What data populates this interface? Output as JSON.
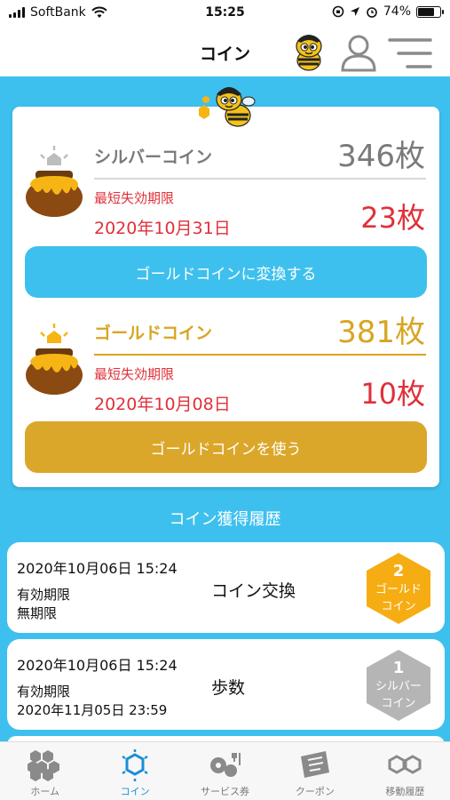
{
  "status_bar": {
    "carrier": "SoftBank",
    "time": "15:25",
    "battery_percent": "74%",
    "battery_level": 0.74
  },
  "header": {
    "title": "コイン",
    "icons": [
      "bee-mascot-icon",
      "user-icon",
      "menu-icon"
    ]
  },
  "silver": {
    "label": "シルバーコイン",
    "count": "346枚",
    "expiry_label": "最短失効期限",
    "expiry_date": "2020年10月31日",
    "expiry_count": "23枚",
    "button_label": "ゴールドコインに変換する"
  },
  "gold": {
    "label": "ゴールドコイン",
    "count": "381枚",
    "expiry_label": "最短失効期限",
    "expiry_date": "2020年10月08日",
    "expiry_count": "10枚",
    "button_label": "ゴールドコインを使う"
  },
  "history": {
    "title": "コイン獲得履歴",
    "items": [
      {
        "date": "2020年10月06日 15:24",
        "expiry_label": "有効期限",
        "expiry_value": "無期限",
        "source": "コイン交換",
        "badge_count": "2",
        "badge_type_line1": "ゴールド",
        "badge_type_line2": "コイン",
        "badge_color": "#f6ad14"
      },
      {
        "date": "2020年10月06日 15:24",
        "expiry_label": "有効期限",
        "expiry_value": "2020年11月05日 23:59",
        "source": "歩数",
        "badge_count": "1",
        "badge_type_line1": "シルバー",
        "badge_type_line2": "コイン",
        "badge_color": "#b5b5b5"
      }
    ]
  },
  "tabs": [
    {
      "label": "ホーム",
      "icon": "honeycomb-icon"
    },
    {
      "label": "コイン",
      "icon": "coin-hexagon-icon",
      "active": true
    },
    {
      "label": "サービス券",
      "icon": "service-ticket-icon"
    },
    {
      "label": "クーポン",
      "icon": "coupon-icon"
    },
    {
      "label": "移動履歴",
      "icon": "route-history-icon"
    }
  ],
  "colors": {
    "background": "#3ec0ee",
    "silver_button": "#3ec0ee",
    "gold_button": "#dba72a",
    "expiry_red": "#e0303a",
    "gold_text": "#d8a522",
    "silver_text": "#7a7a7a",
    "active_tab": "#1a8fd8"
  }
}
